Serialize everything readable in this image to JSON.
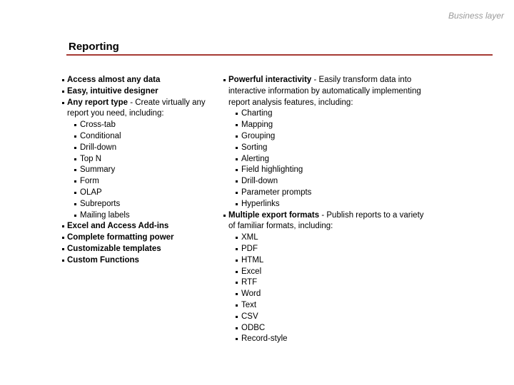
{
  "header": {
    "section_label": "Business layer"
  },
  "title": "Reporting",
  "accent_color": "#a63a34",
  "left_column": {
    "items": [
      {
        "bold": "Access almost any data",
        "text": ""
      },
      {
        "bold": "Easy, intuitive designer",
        "text": ""
      },
      {
        "bold": "Any report type",
        "text": " - Create virtually any report you need, including:",
        "subitems": [
          "Cross-tab",
          "Conditional",
          "Drill-down",
          "Top N",
          "Summary",
          "Form",
          "OLAP",
          "Subreports",
          "Mailing labels"
        ]
      },
      {
        "bold": "Excel and Access Add-ins",
        "text": ""
      },
      {
        "bold": "Complete formatting power",
        "text": ""
      },
      {
        "bold": "Customizable templates",
        "text": ""
      },
      {
        "bold": "Custom Functions",
        "text": ""
      }
    ]
  },
  "right_column": {
    "items": [
      {
        "bold": "Powerful interactivity",
        "text": " - Easily transform data into interactive information by automatically implementing report analysis features, including:",
        "subitems": [
          "Charting",
          "Mapping",
          "Grouping",
          "Sorting",
          "Alerting",
          "Field highlighting",
          "Drill-down",
          "Parameter prompts",
          "Hyperlinks"
        ]
      },
      {
        "bold": "Multiple export formats",
        "text": " - Publish reports to a variety of familiar formats, including:",
        "subitems": [
          "XML",
          "PDF",
          "HTML",
          "Excel",
          "RTF",
          "Word",
          "Text",
          "CSV",
          "ODBC",
          "Record-style"
        ]
      }
    ]
  }
}
